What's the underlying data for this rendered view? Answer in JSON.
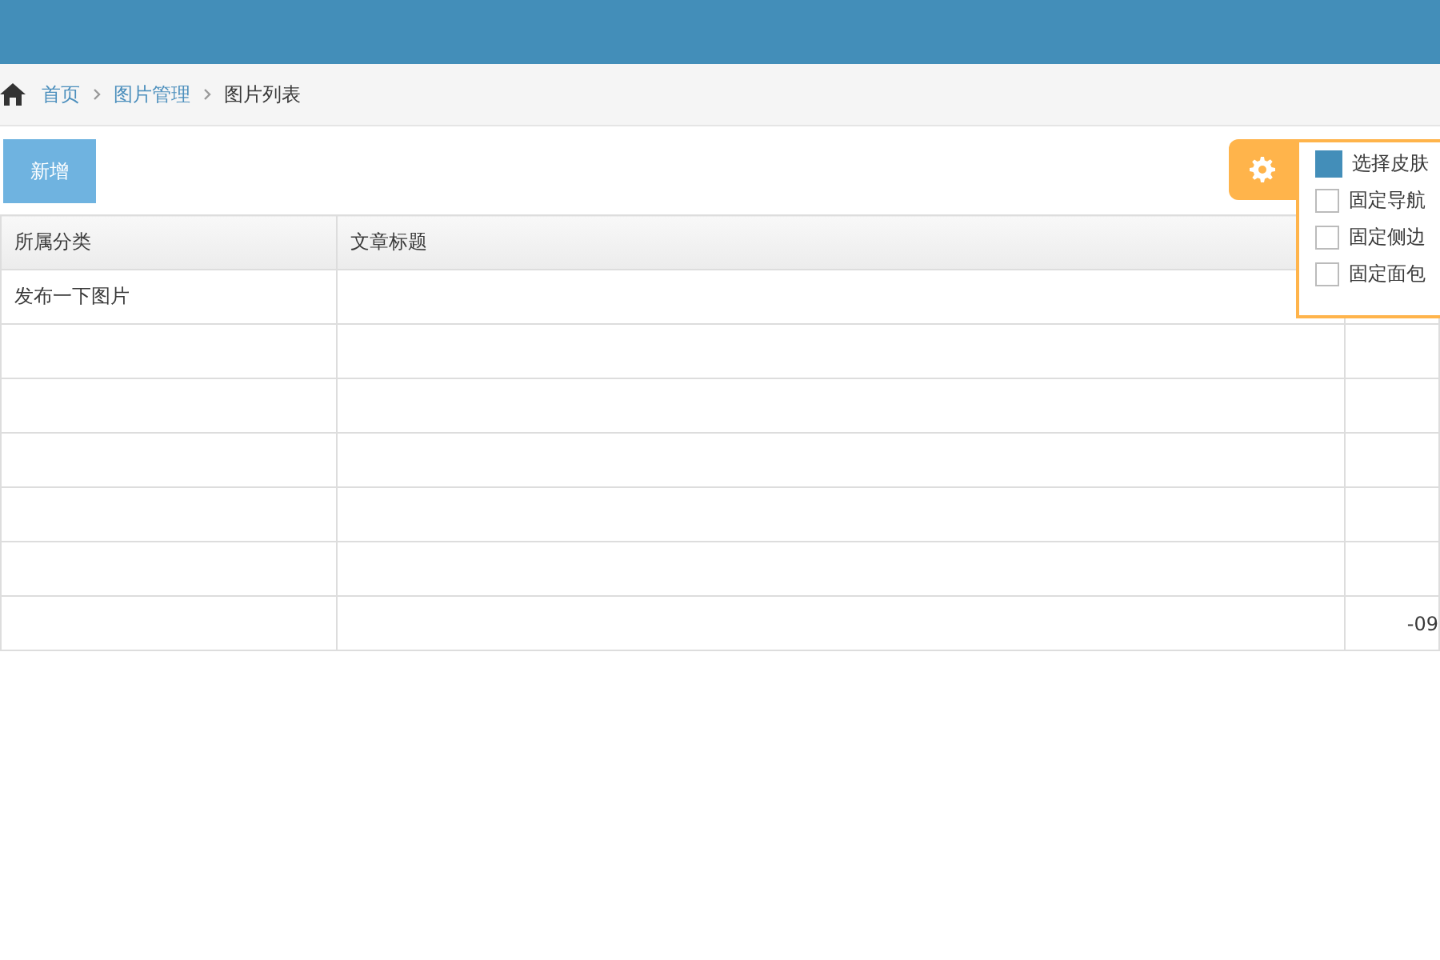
{
  "breadcrumb": [
    {
      "label": "首页",
      "kind": "link"
    },
    {
      "label": "图片管理",
      "kind": "link"
    },
    {
      "label": "图片列表",
      "kind": "current"
    }
  ],
  "add_button": "新增",
  "table": {
    "columns": [
      "所属分类",
      "文章标题"
    ],
    "rows": [
      {
        "category": "发布一下图片",
        "title": "",
        "extra": ""
      },
      {
        "category": "",
        "title": "",
        "extra": ""
      },
      {
        "category": "",
        "title": "",
        "extra": ""
      },
      {
        "category": "",
        "title": "",
        "extra": ""
      },
      {
        "category": "",
        "title": "",
        "extra": ""
      },
      {
        "category": "",
        "title": "",
        "extra": ""
      },
      {
        "category": "",
        "title": "",
        "extra": "-09"
      }
    ]
  },
  "settings_panel": {
    "options": [
      {
        "kind": "skin",
        "label": "选择皮肤",
        "color": "#438eb9"
      },
      {
        "kind": "checkbox",
        "label": "固定导航",
        "checked": false
      },
      {
        "kind": "checkbox",
        "label": "固定侧边",
        "checked": false
      },
      {
        "kind": "checkbox",
        "label": "固定面包",
        "checked": false
      }
    ]
  }
}
